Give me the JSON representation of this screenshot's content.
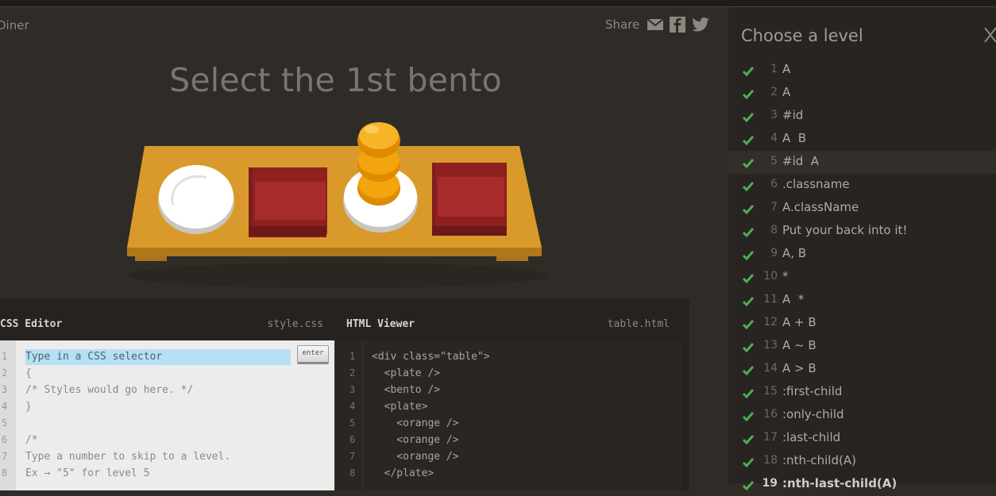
{
  "app": {
    "title": "Diner"
  },
  "share": {
    "label": "Share",
    "icons": [
      "mail-icon",
      "facebook-icon",
      "twitter-icon"
    ]
  },
  "instruction": "Select the 1st bento",
  "editor": {
    "css": {
      "title": "CSS Editor",
      "file": "style.css",
      "placeholder": "Type in a CSS selector",
      "enter_label": "enter",
      "lines": [
        "Type in a CSS selector",
        "{",
        "/* Styles would go here. */",
        "}",
        "",
        "/*",
        "Type a number to skip to a level.",
        "Ex → \"5\" for level 5"
      ],
      "line_numbers": [
        "1",
        "2",
        "3",
        "4",
        "5",
        "6",
        "7",
        "8"
      ]
    },
    "html": {
      "title": "HTML Viewer",
      "file": "table.html",
      "lines": [
        "<div class=\"table\">",
        "  <plate />",
        "  <bento />",
        "  <plate>",
        "    <orange />",
        "    <orange />",
        "    <orange />",
        "  </plate>"
      ],
      "line_numbers": [
        "1",
        "2",
        "3",
        "4",
        "5",
        "6",
        "7",
        "8"
      ]
    }
  },
  "sidebar": {
    "title": "Choose a level",
    "levels": [
      {
        "num": "1",
        "name": "A"
      },
      {
        "num": "2",
        "name": "A"
      },
      {
        "num": "3",
        "name": "#id"
      },
      {
        "num": "4",
        "name": "A  B"
      },
      {
        "num": "5",
        "name": "#id  A"
      },
      {
        "num": "6",
        "name": ".classname"
      },
      {
        "num": "7",
        "name": "A.className"
      },
      {
        "num": "8",
        "name": "Put your back into it!"
      },
      {
        "num": "9",
        "name": "A, B"
      },
      {
        "num": "10",
        "name": "*"
      },
      {
        "num": "11",
        "name": "A  *"
      },
      {
        "num": "12",
        "name": "A + B"
      },
      {
        "num": "13",
        "name": "A ~ B"
      },
      {
        "num": "14",
        "name": "A > B"
      },
      {
        "num": "15",
        "name": ":first-child"
      },
      {
        "num": "16",
        "name": ":only-child"
      },
      {
        "num": "17",
        "name": ":last-child"
      },
      {
        "num": "18",
        "name": ":nth-child(A)"
      },
      {
        "num": "19",
        "name": ":nth-last-child(A)"
      }
    ],
    "active_level": "5"
  },
  "colors": {
    "check": "#4caf50",
    "table": "#d99a2b",
    "bento": "#a82b2b",
    "orange": "#f2a50c"
  }
}
